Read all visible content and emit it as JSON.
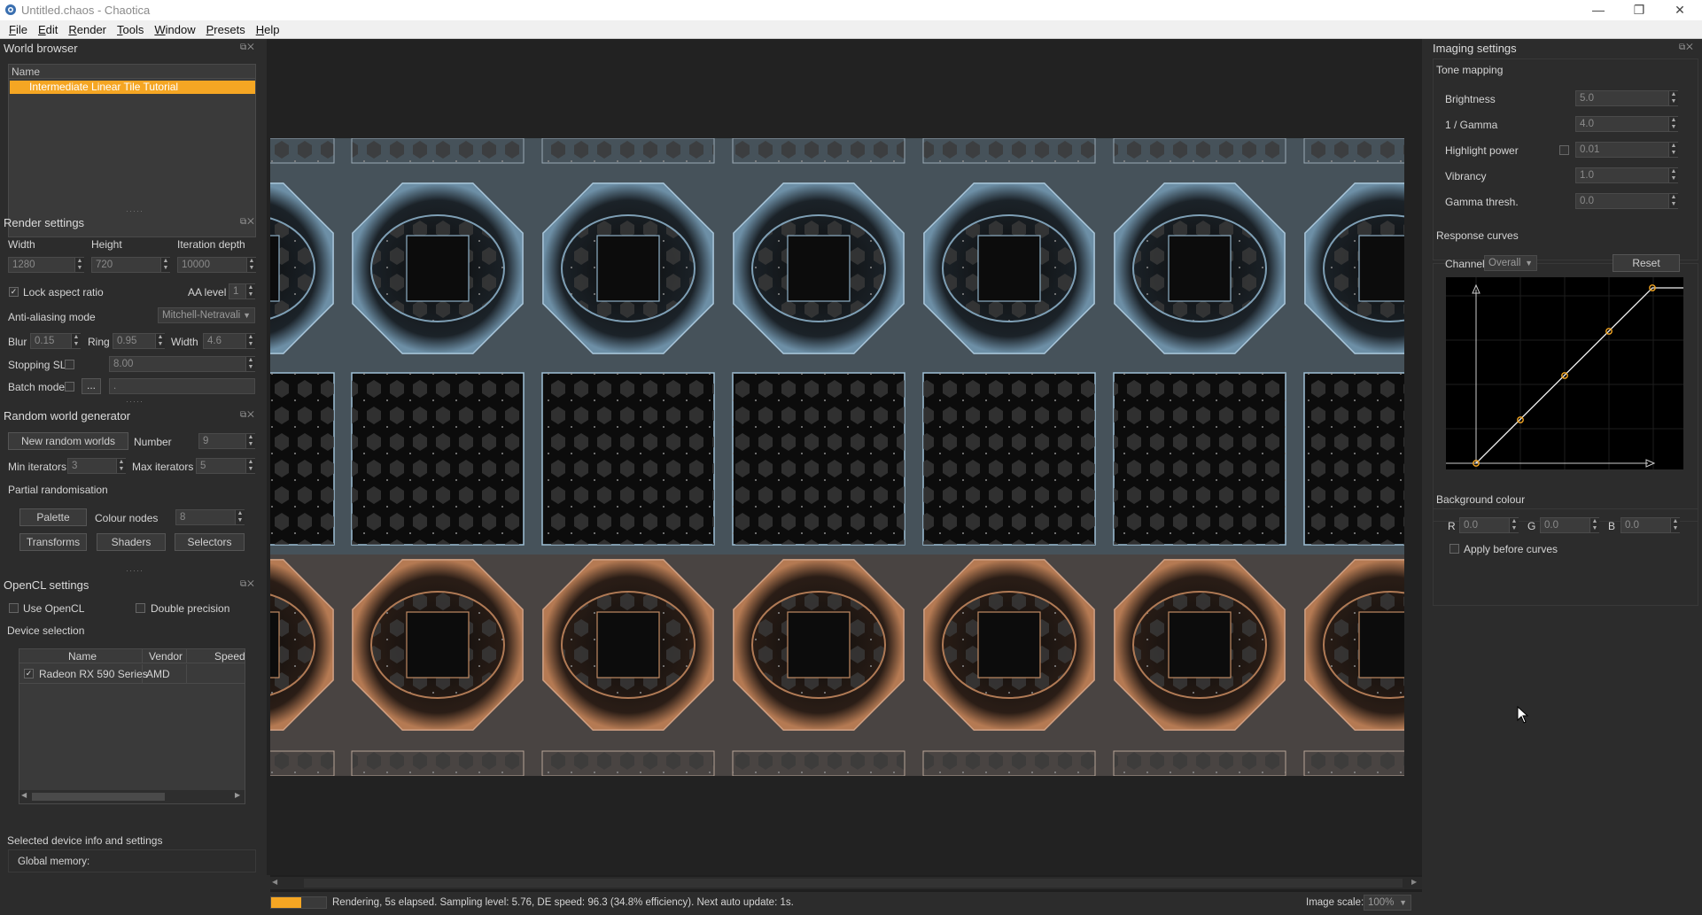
{
  "window": {
    "title": "Untitled.chaos - Chaotica",
    "minimize_icon": "minimize-icon",
    "restore_icon": "restore-icon",
    "close_icon": "close-icon"
  },
  "menu": [
    "File",
    "Edit",
    "Render",
    "Tools",
    "Window",
    "Presets",
    "Help"
  ],
  "world_browser": {
    "title": "World browser",
    "column_header": "Name",
    "selected_item": "Intermediate Linear Tile Tutorial",
    "accent": "#f5a623"
  },
  "render_settings": {
    "title": "Render settings",
    "width_label": "Width",
    "height_label": "Height",
    "iteration_label": "Iteration depth",
    "width_value": "1280",
    "height_value": "720",
    "iteration_value": "10000",
    "lock_aspect_label": "Lock aspect ratio",
    "lock_aspect_checked": "✓",
    "aa_level_label": "AA level",
    "aa_level_value": "1",
    "aa_mode_label": "Anti-aliasing mode",
    "aa_mode_value": "Mitchell-Netravali",
    "blur_label": "Blur",
    "blur_value": "0.15",
    "ring_label": "Ring",
    "ring_value": "0.95",
    "filter_width_label": "Width",
    "filter_width_value": "4.6",
    "stopping_label": "Stopping SL",
    "stopping_value": "8.00",
    "batch_label": "Batch mode",
    "batch_button": "...",
    "batch_value": "."
  },
  "random_world": {
    "title": "Random world generator",
    "new_button": "New random worlds",
    "number_label": "Number",
    "number_value": "9",
    "min_iter_label": "Min iterators",
    "min_iter_value": "3",
    "max_iter_label": "Max iterators",
    "max_iter_value": "5",
    "partial_label": "Partial randomisation",
    "palette_button": "Palette",
    "colour_nodes_label": "Colour nodes",
    "colour_nodes_value": "8",
    "transforms_button": "Transforms",
    "shaders_button": "Shaders",
    "selectors_button": "Selectors"
  },
  "opencl": {
    "title": "OpenCL settings",
    "use_label": "Use OpenCL",
    "double_label": "Double precision",
    "device_selection_label": "Device selection",
    "columns": [
      "Name",
      "Vendor",
      "Speed"
    ],
    "device_checked": "✓",
    "device_name": "Radeon RX 590 Series",
    "device_vendor": "AMD",
    "device_speed": "",
    "info_label": "Selected device info and settings",
    "global_memory_label": "Global memory:"
  },
  "imaging": {
    "title": "Imaging settings",
    "tone_mapping_label": "Tone mapping",
    "brightness_label": "Brightness",
    "brightness_value": "5.0",
    "gamma_label": "1 / Gamma",
    "gamma_value": "4.0",
    "highlight_label": "Highlight power",
    "highlight_value": "0.01",
    "vibrancy_label": "Vibrancy",
    "vibrancy_value": "1.0",
    "gamma_thresh_label": "Gamma thresh.",
    "gamma_thresh_value": "0.0",
    "response_curves_label": "Response curves",
    "channel_label": "Channel:",
    "channel_value": "Overall",
    "reset_button": "Reset",
    "background_label": "Background colour",
    "r_label": "R",
    "r_value": "0.0",
    "g_label": "G",
    "g_value": "0.0",
    "b_label": "B",
    "b_value": "0.0",
    "apply_before_label": "Apply before curves"
  },
  "status": {
    "progress": 0.55,
    "text": "Rendering, 5s elapsed. Sampling level: 5.76, DE speed: 96.3 (34.8% efficiency). Next auto update: 1s.",
    "image_scale_label": "Image scale:",
    "image_scale_value": "100%"
  },
  "colors": {
    "accent": "#f5a623",
    "panel_bg": "#2c2c2c",
    "canvas_bg": "#222222"
  }
}
